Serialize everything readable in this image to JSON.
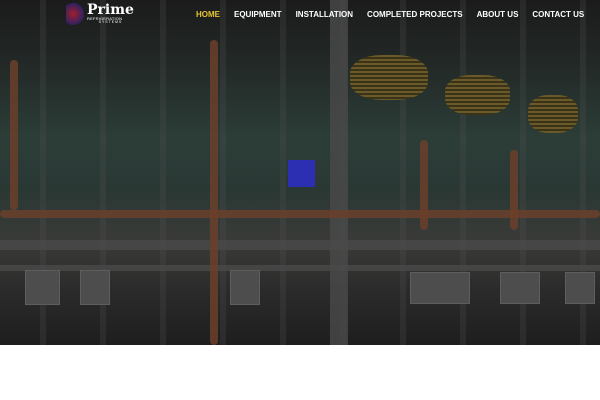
{
  "logo": {
    "name": "Prime",
    "line2": "REFRIGERATION",
    "line3": "SYSTEMS"
  },
  "nav": [
    {
      "label": "HOME",
      "active": true
    },
    {
      "label": "EQUIPMENT"
    },
    {
      "label": "INSTALLATION"
    },
    {
      "label": "COMPLETED PROJECTS"
    },
    {
      "label": "ABOUT US"
    },
    {
      "label": "CONTACT US"
    }
  ],
  "colors": {
    "accent": "#e8c532",
    "highlight": "#2e2fc0"
  }
}
